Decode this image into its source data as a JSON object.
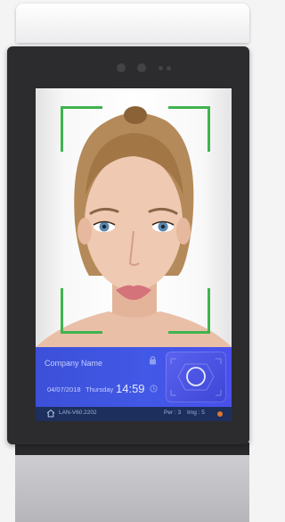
{
  "device": {
    "camera_dots": [
      "camera-lens",
      "camera-lens",
      "sensor-dot",
      "sensor-dot"
    ]
  },
  "face_frame": {
    "color": "#3fb34f"
  },
  "info_panel": {
    "company_name": "Company Name",
    "date": "04/07/2018",
    "weekday": "Thursday",
    "time": "14:59",
    "accent": "#4258e6"
  },
  "status_bar": {
    "version": "LAN-V60.2202",
    "per": "Per : 3",
    "img": "Img : 5"
  }
}
